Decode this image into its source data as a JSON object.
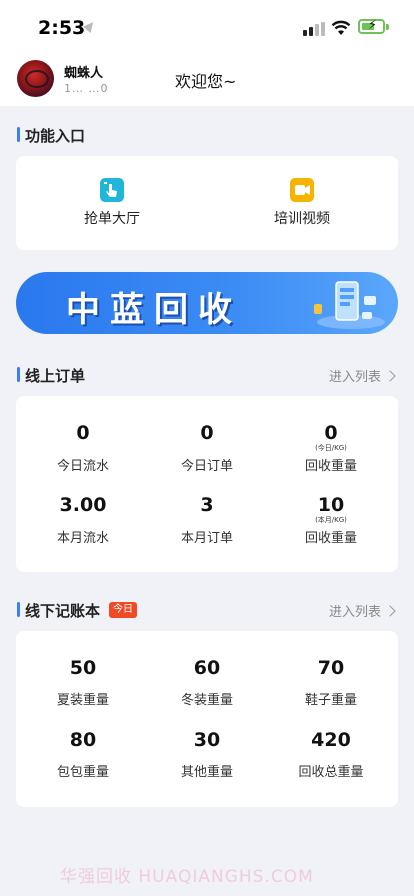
{
  "status_bar": {
    "time": "2:53"
  },
  "header": {
    "username": "蜘蛛人",
    "user_id": "1…  …0",
    "welcome": "欢迎您~"
  },
  "functions": {
    "title": "功能入口",
    "items": [
      {
        "label": "抢单大厅",
        "icon": "hand-tap-icon",
        "color": "#1fb6d9"
      },
      {
        "label": "培训视频",
        "icon": "video-icon",
        "color": "#f5b400"
      }
    ]
  },
  "banner": {
    "text": "中蓝回收"
  },
  "online_orders": {
    "title": "线上订单",
    "more": "进入列表",
    "stats": [
      {
        "value": "0",
        "sub": "",
        "label": "今日流水"
      },
      {
        "value": "0",
        "sub": "",
        "label": "今日订单"
      },
      {
        "value": "0",
        "sub": "(今日/KG)",
        "label": "回收重量"
      },
      {
        "value": "3.00",
        "sub": "",
        "label": "本月流水"
      },
      {
        "value": "3",
        "sub": "",
        "label": "本月订单"
      },
      {
        "value": "10",
        "sub": "(本月/KG)",
        "label": "回收重量"
      }
    ]
  },
  "offline_ledger": {
    "title": "线下记账本",
    "badge": "今日",
    "more": "进入列表",
    "stats": [
      {
        "value": "50",
        "label": "夏装重量"
      },
      {
        "value": "60",
        "label": "冬装重量"
      },
      {
        "value": "70",
        "label": "鞋子重量"
      },
      {
        "value": "80",
        "label": "包包重量"
      },
      {
        "value": "30",
        "label": "其他重量"
      },
      {
        "value": "420",
        "label": "回收总重量"
      }
    ]
  },
  "watermark": "华强回收 HUAQIANGHS.COM",
  "colors": {
    "accent": "#3b7ff0",
    "badge": "#ef4a25",
    "background": "#f1f2f7",
    "battery": "#6fc257"
  }
}
